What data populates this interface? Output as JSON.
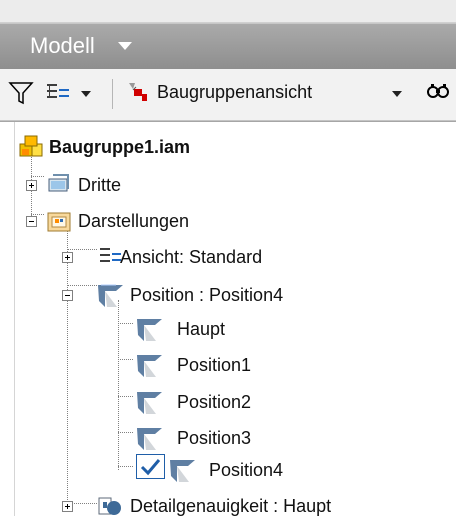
{
  "panel": {
    "title": "Modell",
    "toolbar": {
      "view_label": "Baugruppenansicht",
      "icons": [
        "filter-icon",
        "display-icon",
        "assembly-view-icon",
        "search-icon"
      ]
    }
  },
  "tree": {
    "root": "Baugruppe1.iam",
    "items": [
      {
        "label": "Dritte",
        "icon": "third-icon",
        "expanded": false
      },
      {
        "label": "Darstellungen",
        "icon": "representations-icon",
        "expanded": true
      },
      {
        "label": "Ansicht: Standard",
        "icon": "view-rep-icon",
        "expanded": false
      },
      {
        "label": "Position : Position4",
        "icon": "position-icon",
        "expanded": true
      },
      {
        "label": "Haupt",
        "icon": "position-icon"
      },
      {
        "label": "Position1",
        "icon": "position-icon"
      },
      {
        "label": "Position2",
        "icon": "position-icon"
      },
      {
        "label": "Position3",
        "icon": "position-icon"
      },
      {
        "label": "Position4",
        "icon": "position-icon",
        "checked": true
      },
      {
        "label": "Detailgenauigkeit : Haupt",
        "icon": "level-of-detail-icon",
        "expanded": false
      }
    ]
  },
  "colors": {
    "header": "#9b9b9b",
    "accent": "#2f6db4",
    "tree_bg": "#ffffff"
  }
}
